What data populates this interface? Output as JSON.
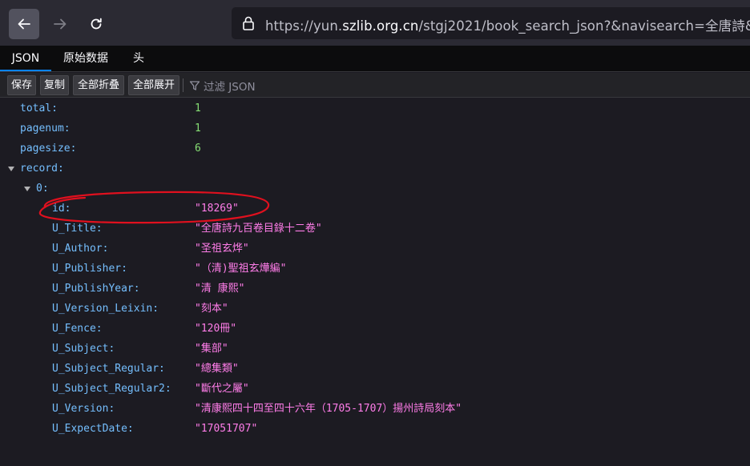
{
  "browser": {
    "url_prefix": "https://yun.",
    "url_host": "szlib.org.cn",
    "url_rest": "/stgj2021/book_search_json?&navisearch=全唐詩&"
  },
  "tabs": [
    "JSON",
    "原始数据",
    "头"
  ],
  "toolbar": {
    "save": "保存",
    "copy": "复制",
    "collapse_all": "全部折叠",
    "expand_all": "全部展开",
    "filter_placeholder": "过滤 JSON"
  },
  "json": {
    "top_fields": [
      {
        "key": "total:",
        "value": "1"
      },
      {
        "key": "pagenum:",
        "value": "1"
      },
      {
        "key": "pagesize:",
        "value": "6"
      }
    ],
    "record_key": "record:",
    "index_key": "0:",
    "record_fields": [
      {
        "key": "id:",
        "value": "\"18269\""
      },
      {
        "key": "U_Title:",
        "value": "\"全唐詩九百卷目錄十二卷\""
      },
      {
        "key": "U_Author:",
        "value": "\"圣祖玄烨\""
      },
      {
        "key": "U_Publisher:",
        "value": "\"（清)聖祖玄燁編\""
      },
      {
        "key": "U_PublishYear:",
        "value": "\"清 康熙\""
      },
      {
        "key": "U_Version_Leixin:",
        "value": "\"刻本\""
      },
      {
        "key": "U_Fence:",
        "value": "\"120冊\""
      },
      {
        "key": "U_Subject:",
        "value": "\"集部\""
      },
      {
        "key": "U_Subject_Regular:",
        "value": "\"總集類\""
      },
      {
        "key": "U_Subject_Regular2:",
        "value": "\"斷代之屬\""
      },
      {
        "key": "U_Version:",
        "value": "\"清康熙四十四至四十六年（1705-1707）揚州詩局刻本\""
      },
      {
        "key": "U_ExpectDate:",
        "value": "\"17051707\""
      }
    ]
  },
  "colors": {
    "key": "#75bfff",
    "number": "#86de74",
    "string": "#ff7de9",
    "annotation": "#e0101e"
  }
}
